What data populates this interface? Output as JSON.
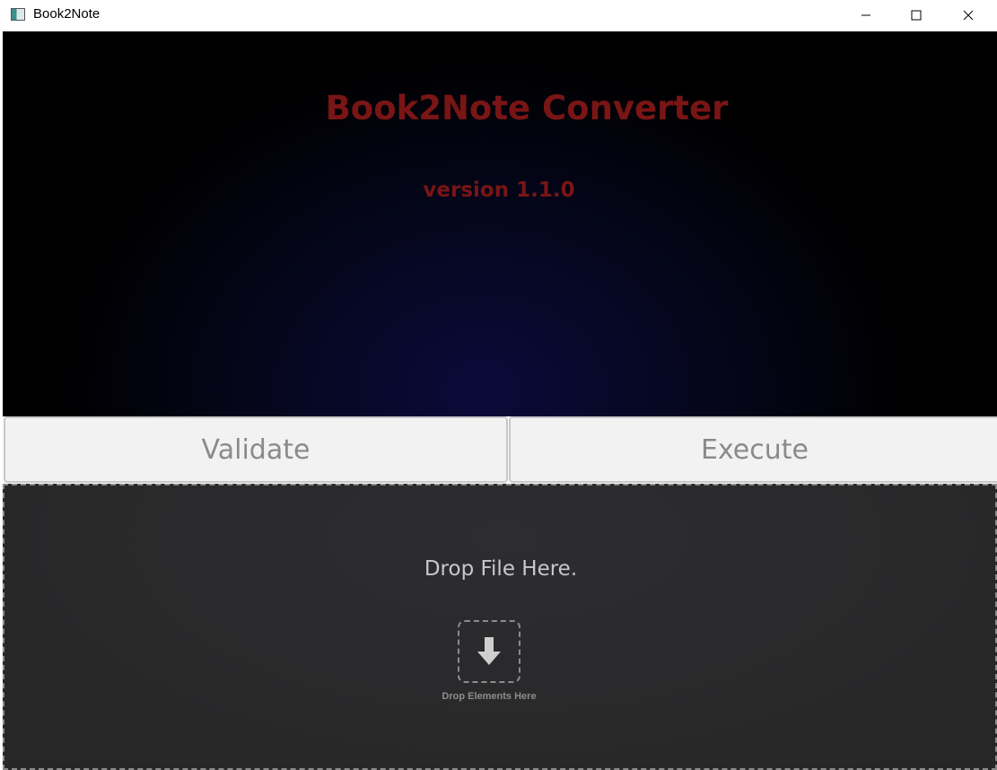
{
  "window": {
    "title": "Book2Note",
    "icon": "app-window-icon",
    "controls": {
      "minimize": "minimize-icon",
      "maximize": "maximize-icon",
      "close": "close-icon"
    }
  },
  "header": {
    "title": "Book2Note Converter",
    "version": "version 1.1.0"
  },
  "actions": {
    "validate_label": "Validate",
    "execute_label": "Execute"
  },
  "dropzone": {
    "prompt": "Drop File Here.",
    "icon": "download-arrow-icon",
    "caption": "Drop Elements Here"
  },
  "colors": {
    "title_text": "#7a1515",
    "header_bg": "#000000",
    "header_glow": "#0a0b3a",
    "button_bg": "#f2f2f2",
    "button_text": "#8a8a8a",
    "dropzone_bg": "#2a2a2c",
    "dropzone_text": "#c8c8c8"
  }
}
